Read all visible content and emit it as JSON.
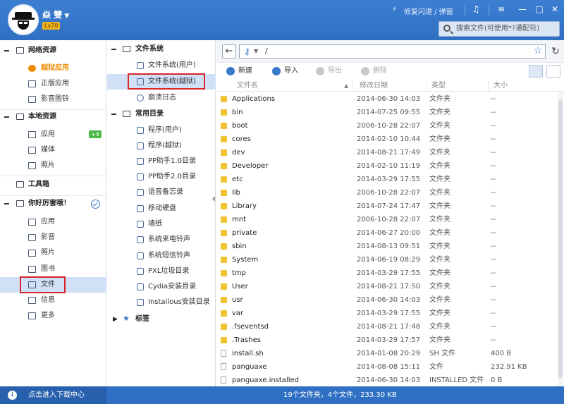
{
  "header": {
    "username": "焱  雙",
    "level": "Lv70",
    "fix_text": "修复闪退 / 弹窗",
    "search_placeholder": "搜索文件(可使用*?通配符)"
  },
  "sidebar": {
    "sections": [
      {
        "label": "网络资源",
        "items": [
          {
            "label": "越狱应用"
          },
          {
            "label": "正版应用"
          },
          {
            "label": "影音图铃"
          }
        ]
      },
      {
        "label": "本地资源",
        "items": [
          {
            "label": "应用",
            "badge": "+4"
          },
          {
            "label": "媒体"
          },
          {
            "label": "照片"
          }
        ]
      },
      {
        "label": "工具箱",
        "items": []
      },
      {
        "label": "你好厉害哦！",
        "items": [
          {
            "label": "应用"
          },
          {
            "label": "影音"
          },
          {
            "label": "照片"
          },
          {
            "label": "图书"
          },
          {
            "label": "文件"
          },
          {
            "label": "信息"
          },
          {
            "label": "更多"
          }
        ]
      }
    ]
  },
  "tree": {
    "filesystem": {
      "label": "文件系统",
      "items": [
        {
          "label": "文件系统(用户)"
        },
        {
          "label": "文件系统(越狱)"
        },
        {
          "label": "崩溃日志"
        }
      ]
    },
    "common": {
      "label": "常用目录",
      "items": [
        {
          "label": "程序(用户)"
        },
        {
          "label": "程序(越狱)"
        },
        {
          "label": "PP助手1.0目录"
        },
        {
          "label": "PP助手2.0目录"
        },
        {
          "label": "语音备忘录"
        },
        {
          "label": "移动硬盘"
        },
        {
          "label": "墙纸"
        },
        {
          "label": "系统来电铃声"
        },
        {
          "label": "系统短信铃声"
        },
        {
          "label": "PXL垃圾目录"
        },
        {
          "label": "Cydia安装目录"
        },
        {
          "label": "Installous安装目录"
        }
      ]
    },
    "tags": {
      "label": "标签"
    }
  },
  "address": {
    "path": "/"
  },
  "toolbar": {
    "new_label": "新建",
    "import_label": "导入",
    "export_label": "导出",
    "delete_label": "删除"
  },
  "columns": {
    "name": "文件名",
    "date": "修改日期",
    "type": "类型",
    "size": "大小"
  },
  "files": [
    {
      "name": "Applications",
      "date": "2014-06-30 14:03",
      "type": "文件夹",
      "size": "--",
      "kind": "folder"
    },
    {
      "name": "bin",
      "date": "2014-07-25 09:55",
      "type": "文件夹",
      "size": "--",
      "kind": "folder"
    },
    {
      "name": "boot",
      "date": "2006-10-28 22:07",
      "type": "文件夹",
      "size": "--",
      "kind": "folder"
    },
    {
      "name": "cores",
      "date": "2014-02-10 10:44",
      "type": "文件夹",
      "size": "--",
      "kind": "folder"
    },
    {
      "name": "dev",
      "date": "2014-08-21 17:49",
      "type": "文件夹",
      "size": "--",
      "kind": "folder"
    },
    {
      "name": "Developer",
      "date": "2014-02-10 11:19",
      "type": "文件夹",
      "size": "--",
      "kind": "folder"
    },
    {
      "name": "etc",
      "date": "2014-03-29 17:55",
      "type": "文件夹",
      "size": "--",
      "kind": "folder"
    },
    {
      "name": "lib",
      "date": "2006-10-28 22:07",
      "type": "文件夹",
      "size": "--",
      "kind": "folder"
    },
    {
      "name": "Library",
      "date": "2014-07-24 17:47",
      "type": "文件夹",
      "size": "--",
      "kind": "folder"
    },
    {
      "name": "mnt",
      "date": "2006-10-28 22:07",
      "type": "文件夹",
      "size": "--",
      "kind": "folder"
    },
    {
      "name": "private",
      "date": "2014-06-27 20:00",
      "type": "文件夹",
      "size": "--",
      "kind": "folder"
    },
    {
      "name": "sbin",
      "date": "2014-08-13 09:51",
      "type": "文件夹",
      "size": "--",
      "kind": "folder"
    },
    {
      "name": "System",
      "date": "2014-06-19 08:29",
      "type": "文件夹",
      "size": "--",
      "kind": "folder"
    },
    {
      "name": "tmp",
      "date": "2014-03-29 17:55",
      "type": "文件夹",
      "size": "--",
      "kind": "folder"
    },
    {
      "name": "User",
      "date": "2014-08-21 17:50",
      "type": "文件夹",
      "size": "--",
      "kind": "folder"
    },
    {
      "name": "usr",
      "date": "2014-06-30 14:03",
      "type": "文件夹",
      "size": "--",
      "kind": "folder"
    },
    {
      "name": "var",
      "date": "2014-03-29 17:55",
      "type": "文件夹",
      "size": "--",
      "kind": "folder"
    },
    {
      "name": ".fseventsd",
      "date": "2014-08-21 17:48",
      "type": "文件夹",
      "size": "--",
      "kind": "folder"
    },
    {
      "name": ".Trashes",
      "date": "2014-03-29 17:57",
      "type": "文件夹",
      "size": "--",
      "kind": "folder"
    },
    {
      "name": "install.sh",
      "date": "2014-01-08 20:29",
      "type": "SH 文件",
      "size": "400 B",
      "kind": "file"
    },
    {
      "name": "panguaxe",
      "date": "2014-08-08 15:11",
      "type": "文件",
      "size": "232.91 KB",
      "kind": "file"
    },
    {
      "name": "panguaxe.installed",
      "date": "2014-06-30 14:03",
      "type": "INSTALLED 文件",
      "size": "0 B",
      "kind": "file"
    }
  ],
  "bottom": {
    "download_center": "点击进入下载中心",
    "status": "19个文件夹，4个文件，233.30 KB"
  }
}
